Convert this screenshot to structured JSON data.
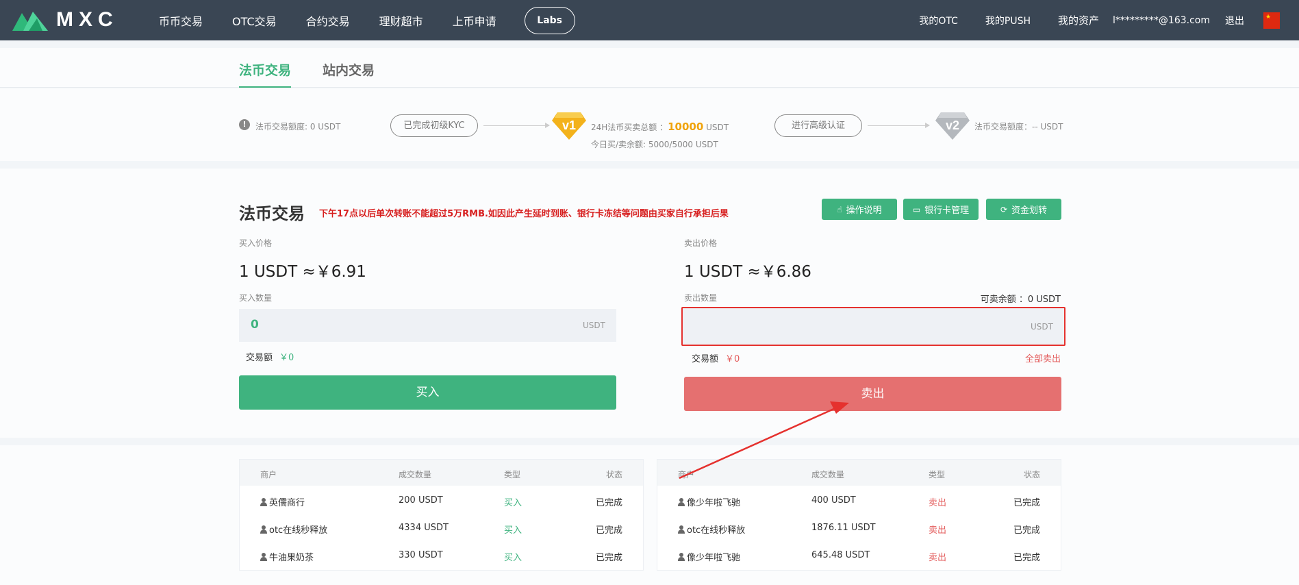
{
  "nav": {
    "brand": "MXC",
    "left_items": [
      "币币交易",
      "OTC交易",
      "合约交易",
      "理财超市",
      "上币申请"
    ],
    "labs": "Labs",
    "right_items": [
      "我的OTC",
      "我的PUSH",
      "我的资产"
    ],
    "user_email": "l*********@163.com",
    "logout": "退出"
  },
  "tabs": {
    "fiat": "法币交易",
    "internal": "站内交易"
  },
  "kyc": {
    "limit_label": "法币交易额度: 0 USDT",
    "kyc_done": "已完成初级KYC",
    "v1": "v1",
    "volume_label": "24H法币买卖总额 ：",
    "volume_value": "10000",
    "volume_unit": "USDT",
    "today_label": "今日买/卖余额: 5000/5000 USDT",
    "advanced": "进行高级认证",
    "v2": "v2",
    "v2_limit": "法币交易额度：-- USDT"
  },
  "trade": {
    "title": "法币交易",
    "notice": "下午17点以后单次转账不能超过5万RMB.如因此产生延时到账、银行卡冻结等问题由买家自行承担后果",
    "btn_guide": "操作说明",
    "btn_bank": "银行卡管理",
    "btn_transfer": "资金划转",
    "buy_price_label": "买入价格",
    "buy_price": "1 USDT ≈￥6.91",
    "buy_qty_label": "买入数量",
    "buy_qty_value": "0",
    "unit": "USDT",
    "buy_amount_label": "交易额",
    "buy_amount_value": "￥0",
    "buy_btn": "买入",
    "sell_price_label": "卖出价格",
    "sell_price": "1 USDT ≈￥6.86",
    "sell_qty_label": "卖出数量",
    "available": "可卖余额 ：0 USDT",
    "sell_amount_label": "交易额",
    "sell_amount_value": "￥0",
    "sell_all": "全部卖出",
    "sell_btn": "卖出"
  },
  "tables": {
    "headers": [
      "商户",
      "成交数量",
      "类型",
      "状态"
    ],
    "buy_rows": [
      {
        "merchant": "英儒商行",
        "qty": "200 USDT",
        "type": "买入",
        "status": "已完成"
      },
      {
        "merchant": "otc在线秒释放",
        "qty": "4334 USDT",
        "type": "买入",
        "status": "已完成"
      },
      {
        "merchant": "牛油果奶茶",
        "qty": "330 USDT",
        "type": "买入",
        "status": "已完成"
      }
    ],
    "sell_rows": [
      {
        "merchant": "像少年啦飞驰",
        "qty": "400 USDT",
        "type": "卖出",
        "status": "已完成"
      },
      {
        "merchant": "otc在线秒释放",
        "qty": "1876.11 USDT",
        "type": "卖出",
        "status": "已完成"
      },
      {
        "merchant": "像少年啦飞驰",
        "qty": "645.48 USDT",
        "type": "卖出",
        "status": "已完成"
      }
    ]
  },
  "colors": {
    "nav_bg": "#3a4654",
    "accent_green": "#3fb37f",
    "sell_red": "#e57070",
    "notice_red": "#d71f1f",
    "highlight_orange": "#f0a30a"
  }
}
